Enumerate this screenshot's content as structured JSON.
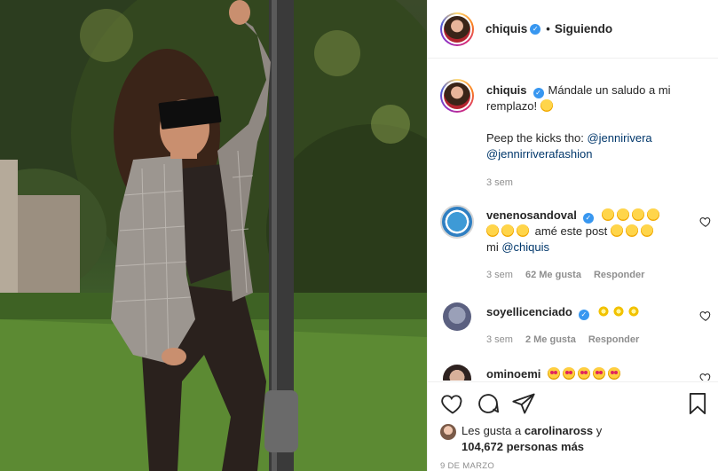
{
  "post": {
    "username": "chiquis",
    "separator": "•",
    "follow_status": "Siguiendo"
  },
  "caption": {
    "username": "chiquis",
    "text_line1": "Mándale un saludo a mi remplazo!",
    "text_line2": "Peep the kicks tho:",
    "mention1": "@jennirivera",
    "mention2": "@jennirriverafashion",
    "time": "3 sem"
  },
  "comments": [
    {
      "username": "venenosandoval",
      "text_before": "amé este post",
      "text_mi": "mi",
      "mention": "@chiquis",
      "time": "3 sem",
      "likes": "62 Me gusta",
      "reply": "Responder"
    },
    {
      "username": "soyellicenciado",
      "time": "3 sem",
      "likes": "2 Me gusta",
      "reply": "Responder"
    },
    {
      "username": "ominoemi"
    }
  ],
  "likes": {
    "prefix": "Les gusta a",
    "user": "carolinaross",
    "conjunction": "y",
    "count": "104,672 personas más"
  },
  "date": "9 DE MARZO",
  "icons": [
    "heart-icon",
    "comment-icon",
    "share-icon",
    "bookmark-icon",
    "verified-icon"
  ],
  "colors": {
    "verified": "#3897f0",
    "mention": "#00376b",
    "muted": "#8e8e8e"
  }
}
